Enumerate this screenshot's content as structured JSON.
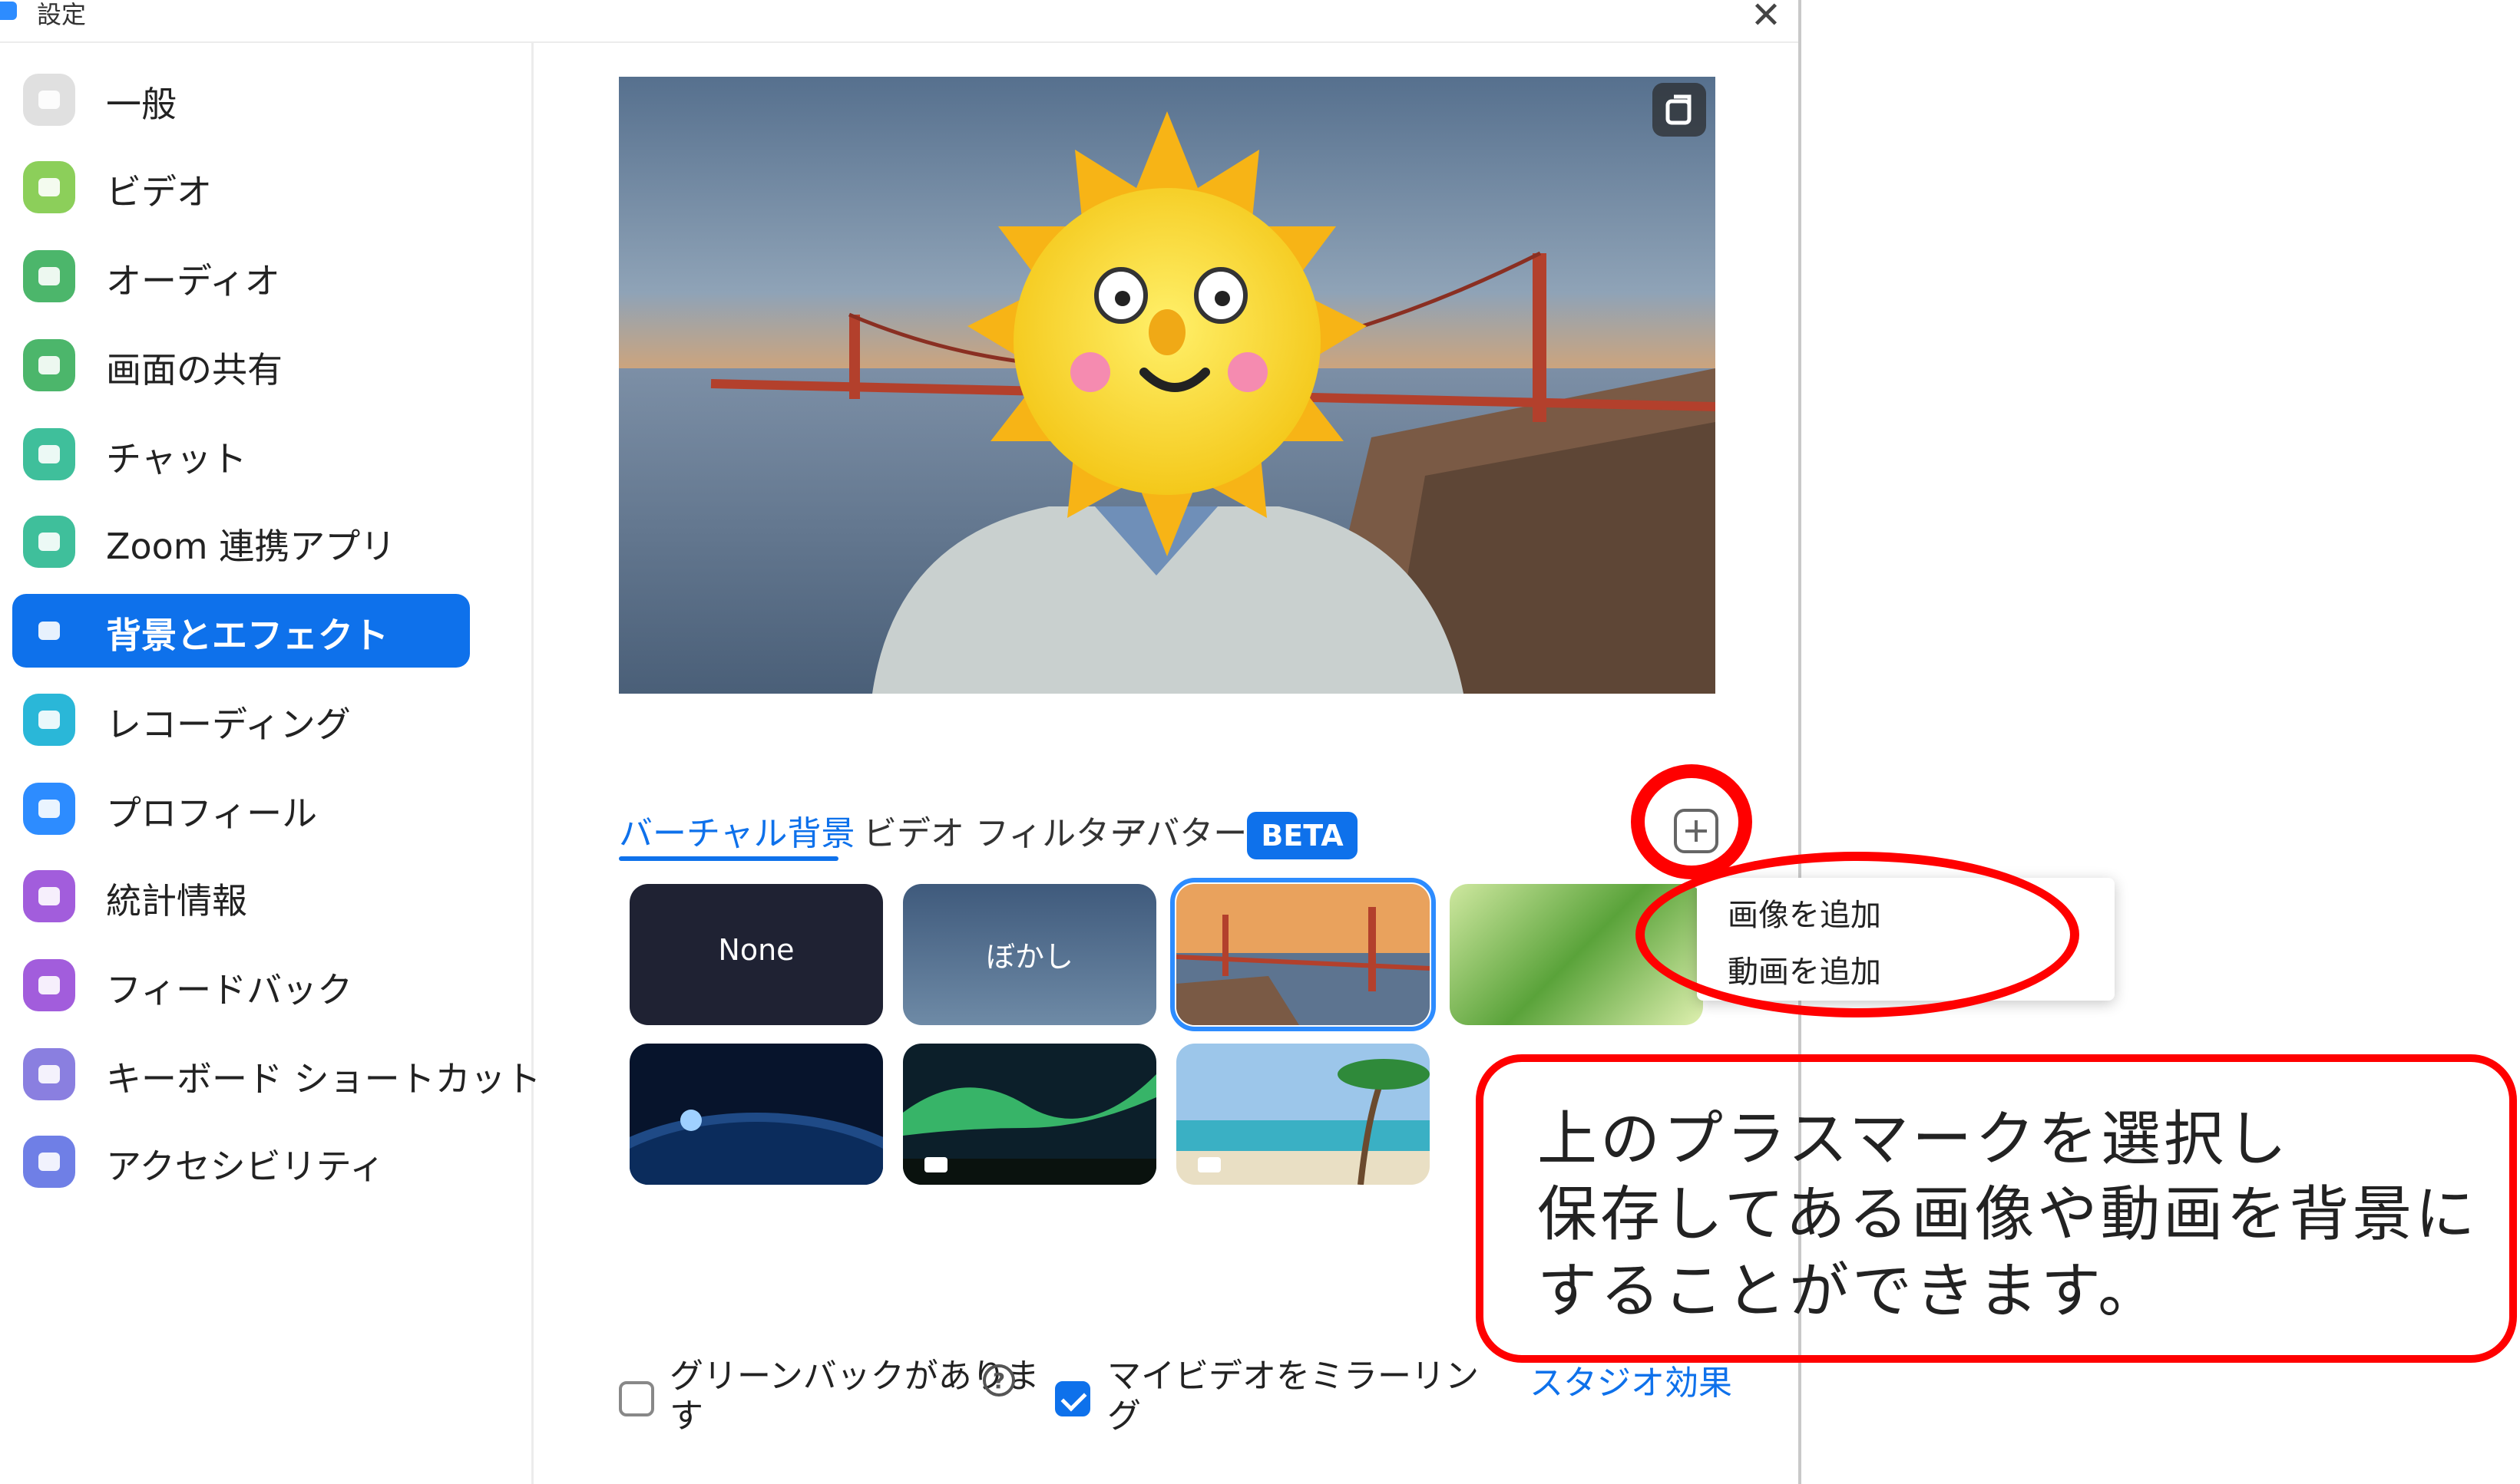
{
  "window": {
    "title": "設定",
    "close_icon": "close-icon"
  },
  "sidebar": {
    "items": [
      {
        "label": "一般",
        "icon": "gear-icon",
        "color": "#e0e0e0"
      },
      {
        "label": "ビデオ",
        "icon": "video-camera-icon",
        "color": "#8ccf5a"
      },
      {
        "label": "オーディオ",
        "icon": "headphones-icon",
        "color": "#4cb66b"
      },
      {
        "label": "画面の共有",
        "icon": "screen-share-icon",
        "color": "#4cb66b"
      },
      {
        "label": "チャット",
        "icon": "chat-bubble-icon",
        "color": "#3fbf9b"
      },
      {
        "label": "Zoom 連携アプリ",
        "icon": "apps-icon",
        "color": "#3fbf9b"
      },
      {
        "label": "背景とエフェクト",
        "icon": "background-icon",
        "color": "#0e71eb",
        "active": true
      },
      {
        "label": "レコーディング",
        "icon": "record-icon",
        "color": "#2ab7d8"
      },
      {
        "label": "プロフィール",
        "icon": "profile-icon",
        "color": "#2d8cff"
      },
      {
        "label": "統計情報",
        "icon": "bar-chart-icon",
        "color": "#a25ddc"
      },
      {
        "label": "フィードバック",
        "icon": "smiley-icon",
        "color": "#a25ddc"
      },
      {
        "label": "キーボード ショートカット",
        "icon": "keyboard-icon",
        "color": "#8a7fe0"
      },
      {
        "label": "アクセシビリティ",
        "icon": "accessibility-icon",
        "color": "#6f7fe6"
      }
    ]
  },
  "tabs": [
    {
      "label": "バーチャル背景",
      "active": true
    },
    {
      "label": "ビデオ フィルター"
    },
    {
      "label": "アバター"
    }
  ],
  "beta_badge": "BETA",
  "thumbnails": [
    {
      "caption": "None"
    },
    {
      "caption": "ぼかし"
    },
    {
      "caption": "",
      "selected": true
    },
    {
      "caption": ""
    },
    {
      "caption": ""
    },
    {
      "caption": ""
    },
    {
      "caption": ""
    }
  ],
  "add_menu": {
    "items": [
      "画像を追加",
      "動画を追加"
    ]
  },
  "annotation": {
    "lines": [
      "上のプラスマークを選択し",
      "保存してある画像や動画を背景に",
      "することができます。"
    ],
    "color": "#ff0000"
  },
  "options": {
    "green_screen": {
      "label_line1": "グリーンバックがありま",
      "label_line2": "す",
      "checked": false
    },
    "mirror": {
      "label_line1": "マイビデオをミラーリン",
      "label_line2": "グ",
      "checked": true
    },
    "studio_effects": "スタジオ効果"
  }
}
